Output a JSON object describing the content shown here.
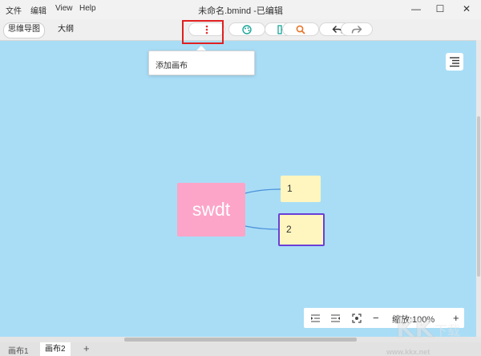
{
  "menubar": {
    "items": [
      "文件",
      "编辑",
      "View",
      "Help"
    ],
    "window_title": "未命名.bmind -已编辑",
    "controls": {
      "minimize": "—",
      "maximize": "☐",
      "close": "✕"
    }
  },
  "toolbar": {
    "view_tabs": [
      "思维导图",
      "大纲"
    ],
    "active_view": "思维导图",
    "buttons": [
      "more-icon",
      "palette-icon",
      "layout-icon",
      "search-icon",
      "undo-icon",
      "redo-icon"
    ],
    "accent_red": "#e0312f",
    "accent_teal": "#1aa69a"
  },
  "popup": {
    "label": "添加画布"
  },
  "mindmap": {
    "root": {
      "label": "swdt",
      "color": "#fca5c9"
    },
    "children": [
      {
        "label": "1",
        "selected": false
      },
      {
        "label": "2",
        "selected": true
      }
    ],
    "subtopic_color": "#fef6be",
    "canvas_color": "#a9ddf6"
  },
  "zoom": {
    "label": "缩放:100%",
    "minus": "−",
    "plus": "+"
  },
  "sheets": {
    "tabs": [
      "画布1",
      "画布2"
    ],
    "active": "画布2",
    "add": "+"
  },
  "watermark": {
    "url": "www.kkx.net"
  }
}
